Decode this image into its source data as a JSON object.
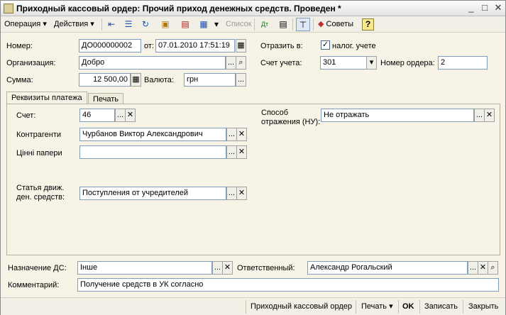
{
  "window": {
    "title": "Приходный кассовый ордер: Прочий приход денежных средств. Проведен *"
  },
  "toolbar": {
    "operation": "Операция",
    "actions": "Действия",
    "list": "Список",
    "advice": "Советы",
    "help": "?"
  },
  "header": {
    "number_label": "Номер:",
    "number_value": "ДО000000002",
    "date_label": "от:",
    "date_value": "07.01.2010 17:51:19",
    "reflect_label": "Отразить в:",
    "tax_label": "налог. учете",
    "tax_checked": true,
    "org_label": "Организация:",
    "org_value": "Добро",
    "account_label": "Счет учета:",
    "account_value": "301",
    "order_no_label": "Номер ордера:",
    "order_no_value": "2",
    "sum_label": "Сумма:",
    "sum_value": "12 500,00",
    "currency_label": "Валюта:",
    "currency_value": "грн"
  },
  "tabs": [
    {
      "label": "Реквизиты платежа"
    },
    {
      "label": "Печать"
    }
  ],
  "payment": {
    "account_label": "Счет:",
    "account_value": "46",
    "counterparty_label": "Контрагенти",
    "counterparty_value": "Чурбанов Виктор Александрович",
    "securities_label": "Цінні папери",
    "securities_value": "",
    "flow_label_1": "Статья движ.",
    "flow_label_2": "ден. средств:",
    "flow_value": "Поступления от учредителей",
    "method_label_1": "Способ",
    "method_label_2": "отражения (НУ):",
    "method_value": "Не отражать"
  },
  "footer": {
    "purpose_label": "Назначение ДС:",
    "purpose_value": "Інше",
    "responsible_label": "Ответственный:",
    "responsible_value": "Александр Рогальский",
    "comment_label": "Комментарий:",
    "comment_value": "Получение средств в УК согласно"
  },
  "bottom": {
    "doc_button": "Приходный кассовый ордер",
    "print_button": "Печать",
    "ok_button": "OK",
    "save_button": "Записать",
    "close_button": "Закрыть"
  },
  "glyphs": {
    "dots": "...",
    "clear": "✕",
    "search": "⌕",
    "dropdown": "▾",
    "check": "✓",
    "calendar": "▦",
    "calc": "▦",
    "minimize": "_",
    "maximize": "□",
    "close": "✕"
  }
}
